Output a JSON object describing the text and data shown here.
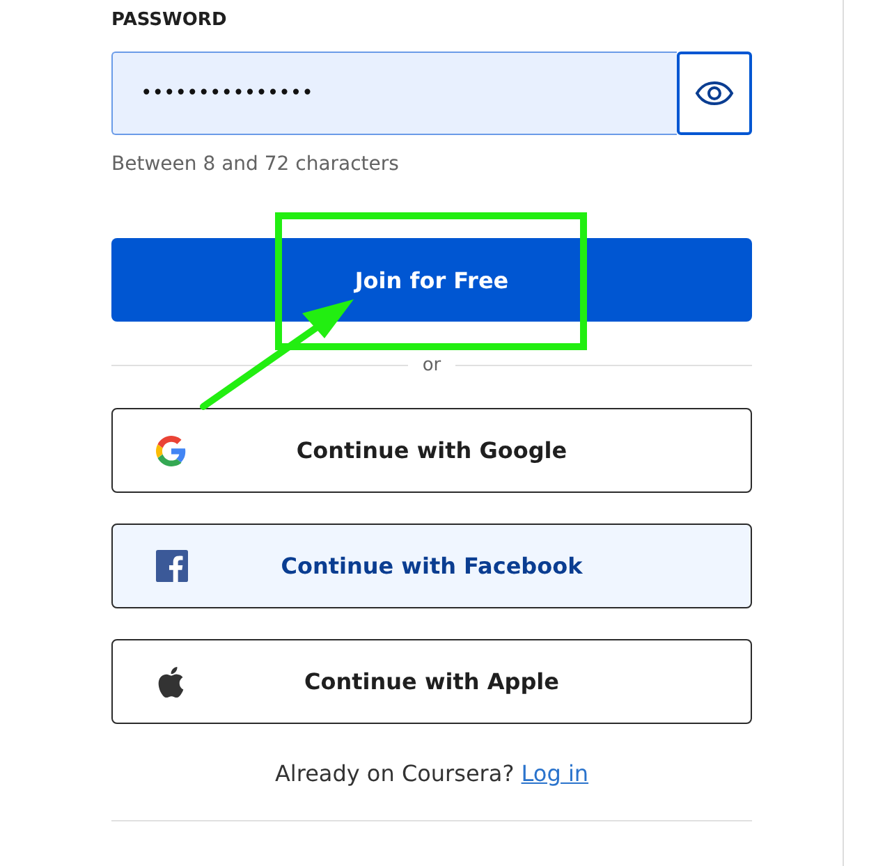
{
  "password": {
    "label": "PASSWORD",
    "value": "•••••••••••••••",
    "hint": "Between 8 and 72 characters",
    "focused": true
  },
  "submit": {
    "label": "Join for Free"
  },
  "divider": "or",
  "social_buttons": [
    {
      "kind": "google",
      "label": "Continue with Google"
    },
    {
      "kind": "facebook",
      "label": "Continue with Facebook"
    },
    {
      "kind": "apple",
      "label": "Continue with Apple"
    }
  ],
  "login_prompt": {
    "text": "Already on Coursera?",
    "link": "Log in"
  }
}
